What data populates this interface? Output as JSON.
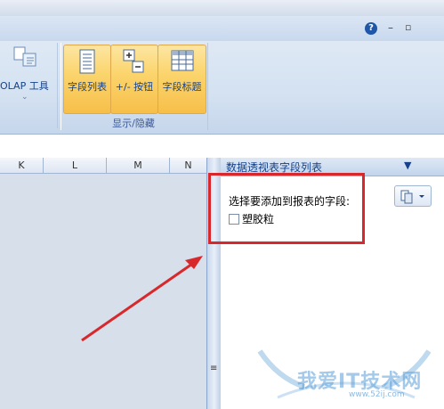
{
  "window": {
    "help_icon": "?",
    "minimize_icon": "–",
    "restore_icon": "▫"
  },
  "ribbon": {
    "olap_label": "OLAP 工具",
    "olap_dropdown": "⌄",
    "buttons": [
      {
        "label": "字段列表",
        "icon": "field-list-icon"
      },
      {
        "label": "+/- 按钮",
        "icon": "plus-minus-icon"
      },
      {
        "label": "字段标题",
        "icon": "field-headers-icon"
      }
    ],
    "group_label": "显示/隐藏"
  },
  "columns": [
    "K",
    "L",
    "M",
    "N"
  ],
  "panel": {
    "title": "数据透视表字段列表",
    "dropdown_icon": "▼",
    "choose_label": "选择要添加到报表的字段:",
    "fields": [
      {
        "name": "塑胶粒",
        "checked": false
      }
    ]
  },
  "annotation": {
    "box_color": "#d8282c",
    "arrow_color": "#d8282c"
  },
  "watermark": {
    "text": "我爱IT技术网",
    "url": "www.52ij.com"
  }
}
